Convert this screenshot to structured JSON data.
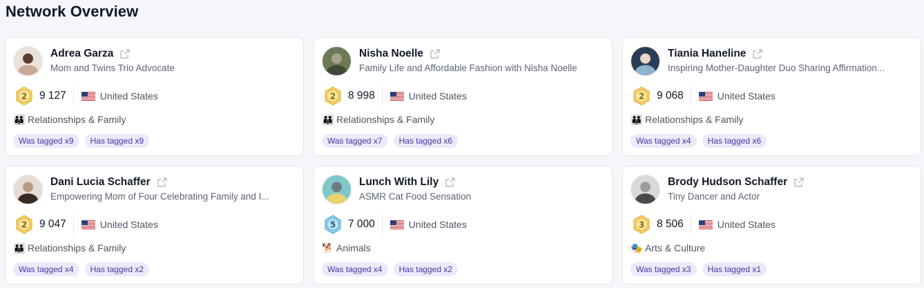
{
  "page": {
    "title": "Network Overview"
  },
  "colors": {
    "tag_bg": "#ede9fb",
    "tag_text": "#4338a1",
    "badge_gold": "#f2c94c",
    "badge_blue": "#7ac7e8"
  },
  "cards": [
    {
      "name": "Adrea Garza",
      "description": "Mom and Twins Trio Advocate",
      "level": "2",
      "badge_style": "gold",
      "followers": "9 127",
      "flag": "us-flag",
      "country": "United States",
      "category_icon": "👪",
      "category": "Relationships & Family",
      "tag_was": "Was tagged x9",
      "tag_has": "Has tagged x9",
      "avatar_colors": [
        "#e9e2da",
        "#c7a996",
        "#5a3d2e"
      ]
    },
    {
      "name": "Nisha Noelle",
      "description": "Family Life and Affordable Fashion with Nisha Noelle",
      "level": "2",
      "badge_style": "gold",
      "followers": "8 998",
      "flag": "us-flag",
      "country": "United States",
      "category_icon": "👪",
      "category": "Relationships & Family",
      "tag_was": "Was tagged x7",
      "tag_has": "Has tagged x6",
      "avatar_colors": [
        "#6d7a57",
        "#3d4a35",
        "#a9a28b"
      ]
    },
    {
      "name": "Tiania Haneline",
      "description": "Inspiring Mother-Daughter Duo Sharing Affirmation...",
      "level": "2",
      "badge_style": "gold",
      "followers": "9 068",
      "flag": "us-flag",
      "country": "United States",
      "category_icon": "👪",
      "category": "Relationships & Family",
      "tag_was": "Was tagged x4",
      "tag_has": "Has tagged x6",
      "avatar_colors": [
        "#2b3d55",
        "#8db3cf",
        "#e8d7c5"
      ]
    },
    {
      "name": "Dani Lucia Schaffer",
      "description": "Empowering Mom of Four Celebrating Family and I...",
      "level": "2",
      "badge_style": "gold",
      "followers": "9 047",
      "flag": "us-flag",
      "country": "United States",
      "category_icon": "👪",
      "category": "Relationships & Family",
      "tag_was": "Was tagged x4",
      "tag_has": "Has tagged x2",
      "avatar_colors": [
        "#e5ddd4",
        "#3a2a24",
        "#b89a85"
      ]
    },
    {
      "name": "Lunch With Lily",
      "description": "ASMR Cat Food Sensation",
      "level": "5",
      "badge_style": "blue",
      "followers": "7 000",
      "flag": "us-flag",
      "country": "United States",
      "category_icon": "🐕",
      "category": "Animals",
      "tag_was": "Was tagged x4",
      "tag_has": "Has tagged x2",
      "avatar_colors": [
        "#7fc7c9",
        "#e9d36a",
        "#6e7b82"
      ]
    },
    {
      "name": "Brody Hudson Schaffer",
      "description": "Tiny Dancer and Actor",
      "level": "3",
      "badge_style": "gold",
      "followers": "8 506",
      "flag": "us-flag",
      "country": "United States",
      "category_icon": "🎭",
      "category": "Arts & Culture",
      "tag_was": "Was tagged x3",
      "tag_has": "Has tagged x1",
      "avatar_colors": [
        "#d9d9d9",
        "#4a4a4a",
        "#9b9b9b"
      ]
    }
  ]
}
